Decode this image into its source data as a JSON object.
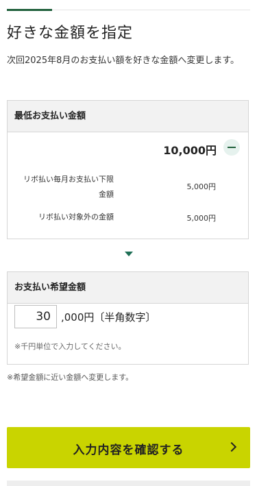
{
  "page": {
    "title": "好きな金額を指定",
    "description": "次回2025年8月のお支払い額を好きな金額へ変更します。"
  },
  "min_payment": {
    "header": "最低お支払い金額",
    "total": "10,000円",
    "toggle_icon": "minus-icon",
    "rows": [
      {
        "label": "リボ払い毎月お支払い下限金額",
        "value": "5,000円"
      },
      {
        "label": "リボ払い対象外の金額",
        "value": "5,000円"
      }
    ]
  },
  "desired_payment": {
    "header": "お支払い希望金額",
    "input_value": "30",
    "input_suffix": ",000円〔半角数字〕",
    "note": "※千円単位で入力してください。"
  },
  "outer_note": "※希望金額に近い金額へ変更します。",
  "confirm_button": {
    "label": "入力内容を確認する",
    "icon": "chevron-right-icon"
  },
  "colors": {
    "accent": "#1e5f3a",
    "button": "#c9d400"
  }
}
